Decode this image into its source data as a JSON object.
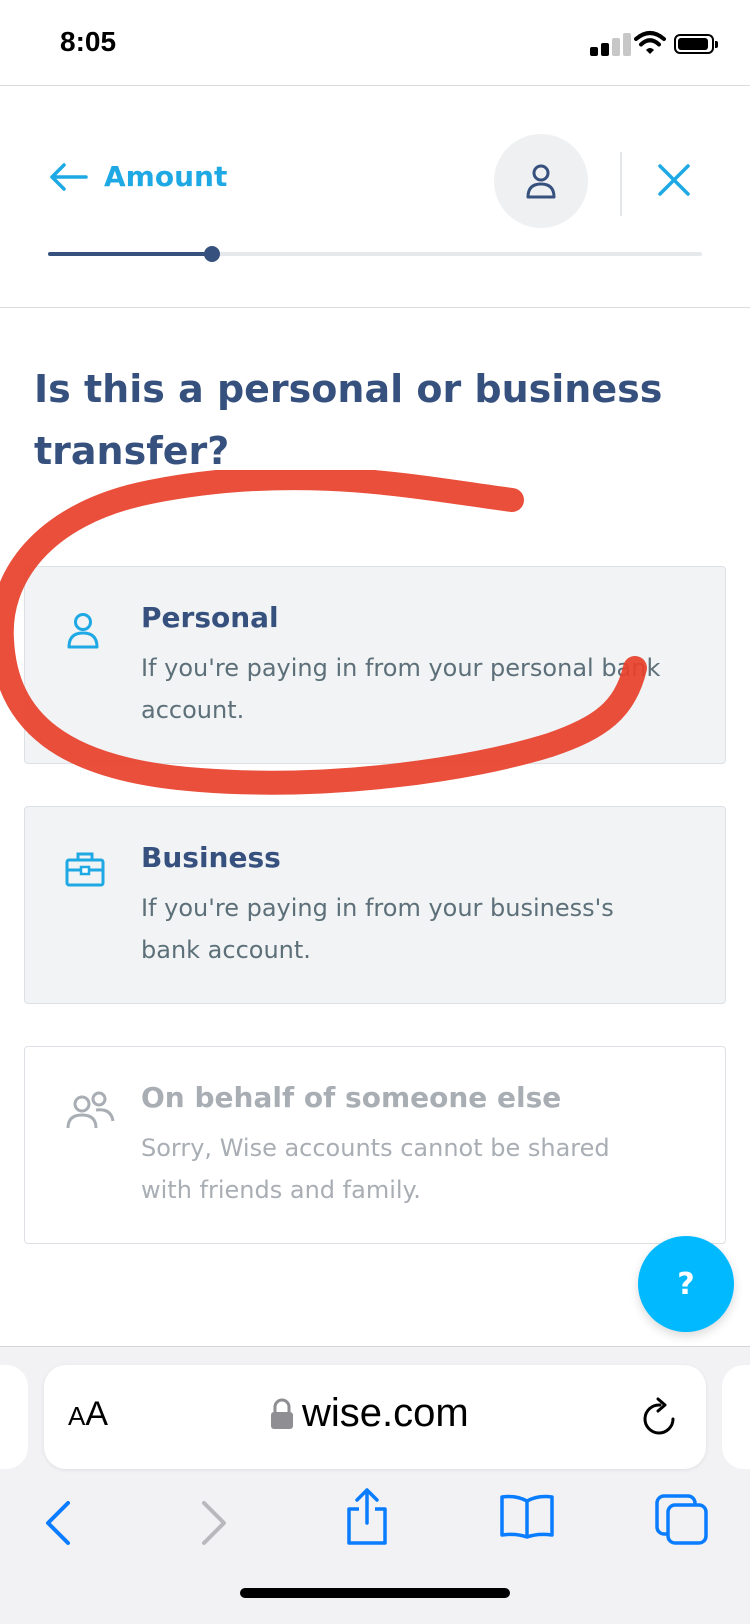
{
  "status_bar": {
    "time": "8:05"
  },
  "header": {
    "back_label": "Amount",
    "progress_fraction": 0.25
  },
  "main": {
    "question": "Is this a personal or business transfer?",
    "options": [
      {
        "title": "Personal",
        "description": "If you're paying in from your personal bank account."
      },
      {
        "title": "Business",
        "description": "If you're paying in from your business's bank account."
      },
      {
        "title": "On behalf of someone else",
        "description": "Sorry, Wise accounts cannot be shared with friends and family."
      }
    ],
    "help_label": "?"
  },
  "browser": {
    "aa_small": "A",
    "aa_big": "A",
    "url": "wise.com"
  },
  "icons": {
    "back": "arrow-left-icon",
    "profile": "person-icon",
    "close": "close-icon",
    "personal": "person-icon",
    "business": "briefcase-icon",
    "someone_else": "people-icon",
    "lock": "lock-icon",
    "reload": "reload-icon"
  },
  "colors": {
    "accent": "#1ea8e4",
    "navy": "#37517e",
    "help": "#00b9ff",
    "annotation": "#e8402a",
    "ios_blue": "#0a7cff"
  }
}
